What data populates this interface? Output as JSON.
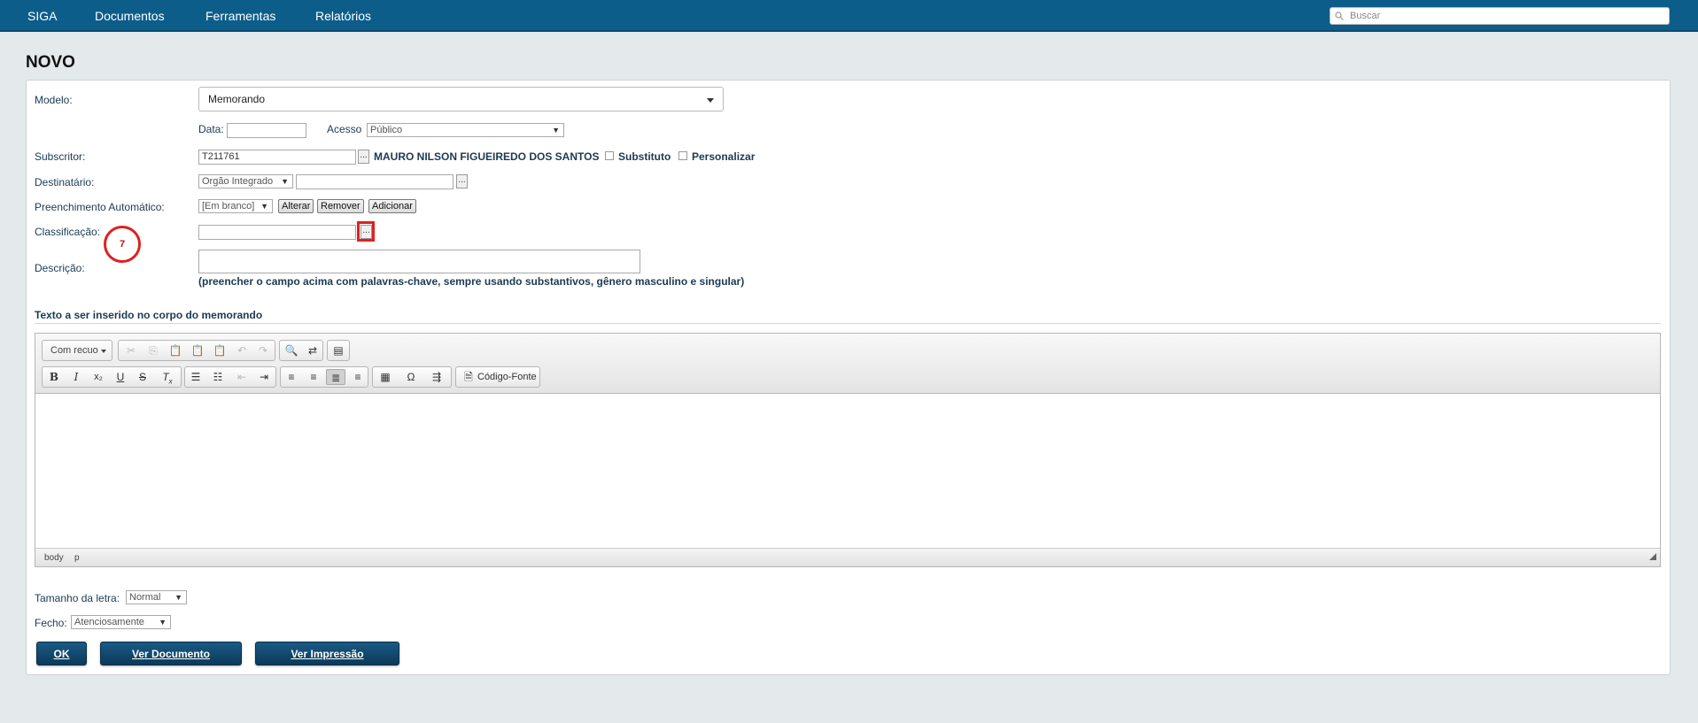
{
  "nav": {
    "items": [
      "SIGA",
      "Documentos",
      "Ferramentas",
      "Relatórios"
    ],
    "search_placeholder": "Buscar"
  },
  "page_title": "NOVO",
  "form": {
    "modelo_label": "Modelo:",
    "modelo_value": "Memorando",
    "data_label": "Data:",
    "acesso_label": "Acesso",
    "acesso_value": "Público",
    "subscritor_label": "Subscritor:",
    "subscritor_code": "T211761",
    "subscritor_name": "MAURO NILSON FIGUEIREDO DOS SANTOS",
    "substituto_label": "Substituto",
    "personalizar_label": "Personalizar",
    "destinatario_label": "Destinatário:",
    "destinatario_type": "Orgão Integrado",
    "preenchimento_label": "Preenchimento Automático:",
    "preenchimento_value": "[Em branco]",
    "alterar_label": "Alterar",
    "remover_label": "Remover",
    "adicionar_label": "Adicionar",
    "classificacao_label": "Classificação:",
    "descricao_label": "Descrição:",
    "descricao_hint": "(preencher o campo acima com palavras-chave, sempre usando substantivos, gênero masculino e singular)",
    "dots": "..."
  },
  "editor": {
    "section_title": "Texto a ser inserido no corpo do memorando",
    "styles_combo": "Com recuo",
    "source_label": "Código-Fonte",
    "status_path": [
      "body",
      "p"
    ]
  },
  "footer": {
    "tamanho_label": "Tamanho da letra:",
    "tamanho_value": "Normal",
    "fecho_label": "Fecho:",
    "fecho_value": "Atenciosamente",
    "ok_label": "OK",
    "ver_documento_label": "Ver Documento",
    "ver_impressao_label": "Ver Impressão"
  },
  "annotation": {
    "step_number": "7"
  },
  "colors": {
    "navbar": "#0d5d8a",
    "annotation": "#e02020",
    "primary_button": "#0b3a5a"
  }
}
